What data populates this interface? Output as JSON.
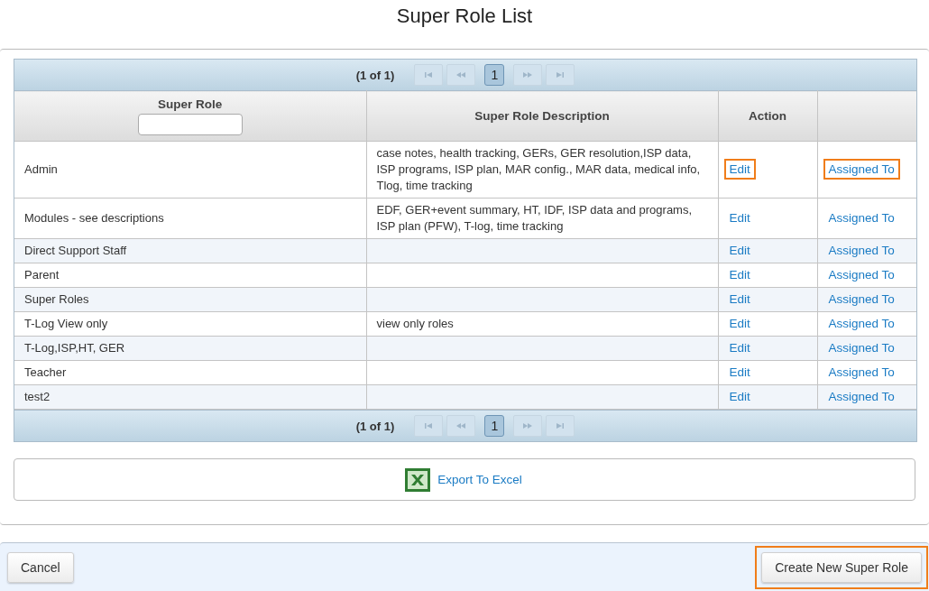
{
  "title": "Super Role List",
  "pager_top": {
    "summary": "(1 of 1)",
    "first_disabled": true,
    "prev_disabled": true,
    "next_disabled": true,
    "last_disabled": true,
    "pages": [
      {
        "label": "1",
        "selected": true
      }
    ]
  },
  "table": {
    "columns": [
      {
        "label": "Super Role",
        "kind": "filter"
      },
      {
        "label": "Super Role Description",
        "kind": "plain"
      },
      {
        "label": "Action",
        "kind": "plain"
      },
      {
        "kind": "plain"
      }
    ],
    "rows": [
      {
        "role": "Admin",
        "description": "case notes, health tracking, GERs, GER resolution,ISP data, ISP programs, ISP plan, MAR config., MAR data, medical info, Tlog, time tracking",
        "edit": "Edit",
        "assigned": "Assigned To",
        "highlighted": true
      },
      {
        "role": "Modules - see descriptions",
        "description": "EDF, GER+event summary, HT, IDF, ISP data and programs, ISP plan (PFW), T-log, time tracking",
        "edit": "Edit",
        "assigned": "Assigned To",
        "highlighted": false
      },
      {
        "role": "Direct Support Staff",
        "description": "",
        "edit": "Edit",
        "assigned": "Assigned To",
        "highlighted": false
      },
      {
        "role": "Parent",
        "description": "",
        "edit": "Edit",
        "assigned": "Assigned To",
        "highlighted": false
      },
      {
        "role": "Super Roles",
        "description": "",
        "edit": "Edit",
        "assigned": "Assigned To",
        "highlighted": false
      },
      {
        "role": "T-Log View only",
        "description": "view only roles",
        "edit": "Edit",
        "assigned": "Assigned To",
        "highlighted": false
      },
      {
        "role": "T-Log,ISP,HT, GER",
        "description": "",
        "edit": "Edit",
        "assigned": "Assigned To",
        "highlighted": false
      },
      {
        "role": "Teacher",
        "description": "",
        "edit": "Edit",
        "assigned": "Assigned To",
        "highlighted": false
      },
      {
        "role": "test2",
        "description": "",
        "edit": "Edit",
        "assigned": "Assigned To",
        "highlighted": false
      }
    ]
  },
  "pager_bottom": {
    "summary": "(1 of 1)",
    "first_disabled": true,
    "prev_disabled": true,
    "next_disabled": true,
    "last_disabled": true,
    "pages": [
      {
        "label": "1",
        "selected": true
      }
    ]
  },
  "export_link": "Export To Excel",
  "footer": {
    "cancel": {
      "label": "Cancel"
    },
    "create": {
      "label": "Create New Super Role",
      "highlighted": true
    }
  }
}
